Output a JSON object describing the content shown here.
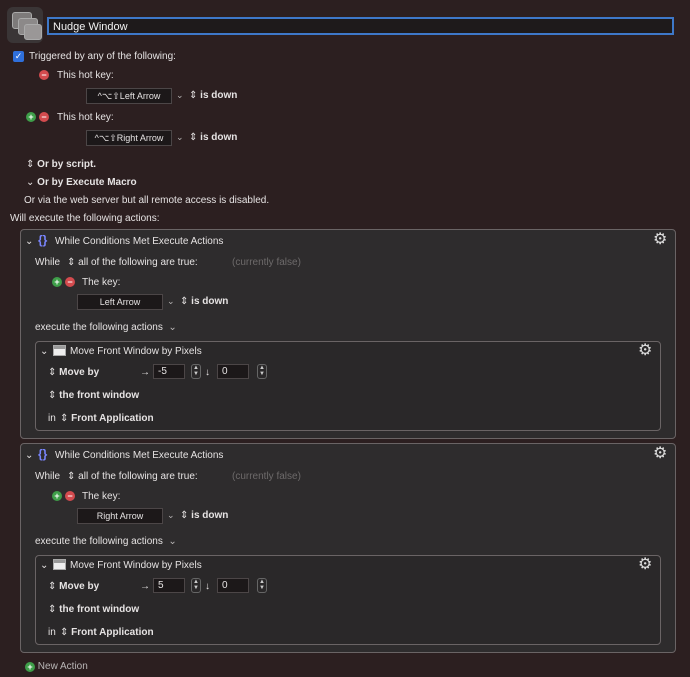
{
  "macro": {
    "name": "Nudge Window",
    "trigger_heading": "Triggered by any of the following:",
    "hotkey_label": "This hot key:",
    "hotkey1": {
      "keys": "^⌥⇧Left Arrow",
      "state": "is down"
    },
    "hotkey2": {
      "keys": "^⌥⇧Right Arrow",
      "state": "is down"
    },
    "or_by_script": "Or by script.",
    "or_by_execute": "Or by Execute Macro",
    "web_server_note": "Or via the web server but all remote access is disabled.",
    "will_execute": "Will execute the following actions:"
  },
  "actions": [
    {
      "title": "While Conditions Met Execute Actions",
      "while_label": "While",
      "condition_scope": "all of the following are true:",
      "status": "(currently false)",
      "the_key_label": "The key:",
      "key": "Left Arrow",
      "key_state": "is down",
      "execute_label": "execute the following actions",
      "sub": {
        "title": "Move Front Window by Pixels",
        "move_by": "Move by",
        "right_arrow": "→",
        "down_arrow": "↓",
        "dx": "-5",
        "dy": "0",
        "target": "the front window",
        "in_label": "in",
        "app": "Front Application"
      }
    },
    {
      "title": "While Conditions Met Execute Actions",
      "while_label": "While",
      "condition_scope": "all of the following are true:",
      "status": "(currently false)",
      "the_key_label": "The key:",
      "key": "Right Arrow",
      "key_state": "is down",
      "execute_label": "execute the following actions",
      "sub": {
        "title": "Move Front Window by Pixels",
        "move_by": "Move by",
        "right_arrow": "→",
        "down_arrow": "↓",
        "dx": "5",
        "dy": "0",
        "target": "the front window",
        "in_label": "in",
        "app": "Front Application"
      }
    }
  ],
  "new_action": "New Action",
  "icons": {
    "gear": "gear-icon",
    "brace": "braces-icon",
    "window": "window-icon",
    "updown": "updown-chevron-icon",
    "disclosure": "disclosure-chevron-icon"
  },
  "colors": {
    "background": "#2c1f20",
    "accent_blue": "#3e78c9",
    "remove_red": "#d34b4e",
    "add_green": "#3e9e49",
    "brace_purple": "#7a86ff"
  }
}
